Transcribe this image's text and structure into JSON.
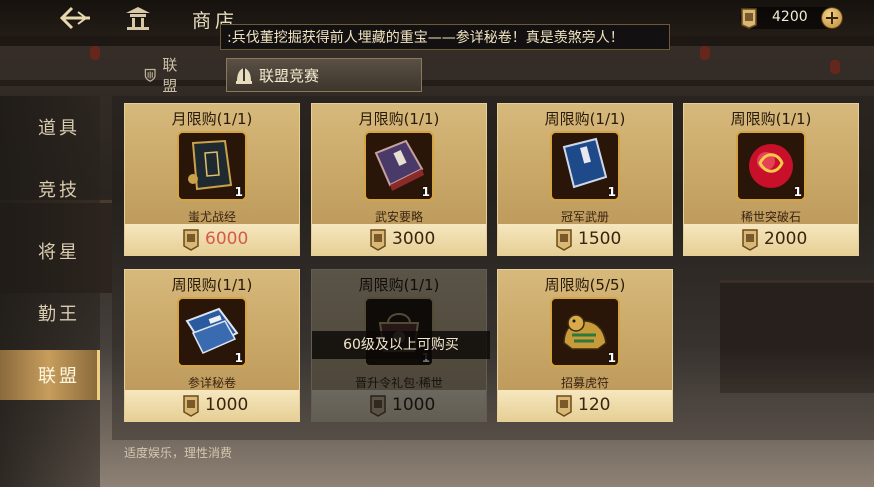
{
  "header": {
    "title": "商店",
    "marquee": ":兵伐董挖掘获得前人埋藏的重宝——参详秘卷！真是羡煞旁人！",
    "currency": "4200"
  },
  "subtabs": [
    {
      "label": "联盟"
    },
    {
      "label": "联盟竞赛"
    }
  ],
  "nav": [
    {
      "label": "道具"
    },
    {
      "label": "竞技"
    },
    {
      "label": "将星"
    },
    {
      "label": "勤王"
    },
    {
      "label": "联盟"
    }
  ],
  "items": [
    {
      "limit": "月限购(1/1)",
      "name": "蚩尤战经",
      "qty": "1",
      "price": "6000"
    },
    {
      "limit": "月限购(1/1)",
      "name": "武安要略",
      "qty": "1",
      "price": "3000"
    },
    {
      "limit": "周限购(1/1)",
      "name": "冠军武册",
      "qty": "1",
      "price": "1500"
    },
    {
      "limit": "周限购(1/1)",
      "name": "稀世突破石",
      "qty": "1",
      "price": "2000"
    },
    {
      "limit": "周限购(1/1)",
      "name": "参详秘卷",
      "qty": "1",
      "price": "1000"
    },
    {
      "limit": "周限购(1/1)",
      "name": "晋升令礼包·稀世",
      "qty": "1",
      "price": "1000"
    },
    {
      "limit": "周限购(5/5)",
      "name": "招募虎符",
      "qty": "1",
      "price": "120"
    }
  ],
  "lock_note": "60级及以上可购买",
  "footer": "适度娱乐，理性消费",
  "colors": {
    "accent": "#c79d5c",
    "price_insufficient": "#d65a4a",
    "card": "#c9a868"
  }
}
